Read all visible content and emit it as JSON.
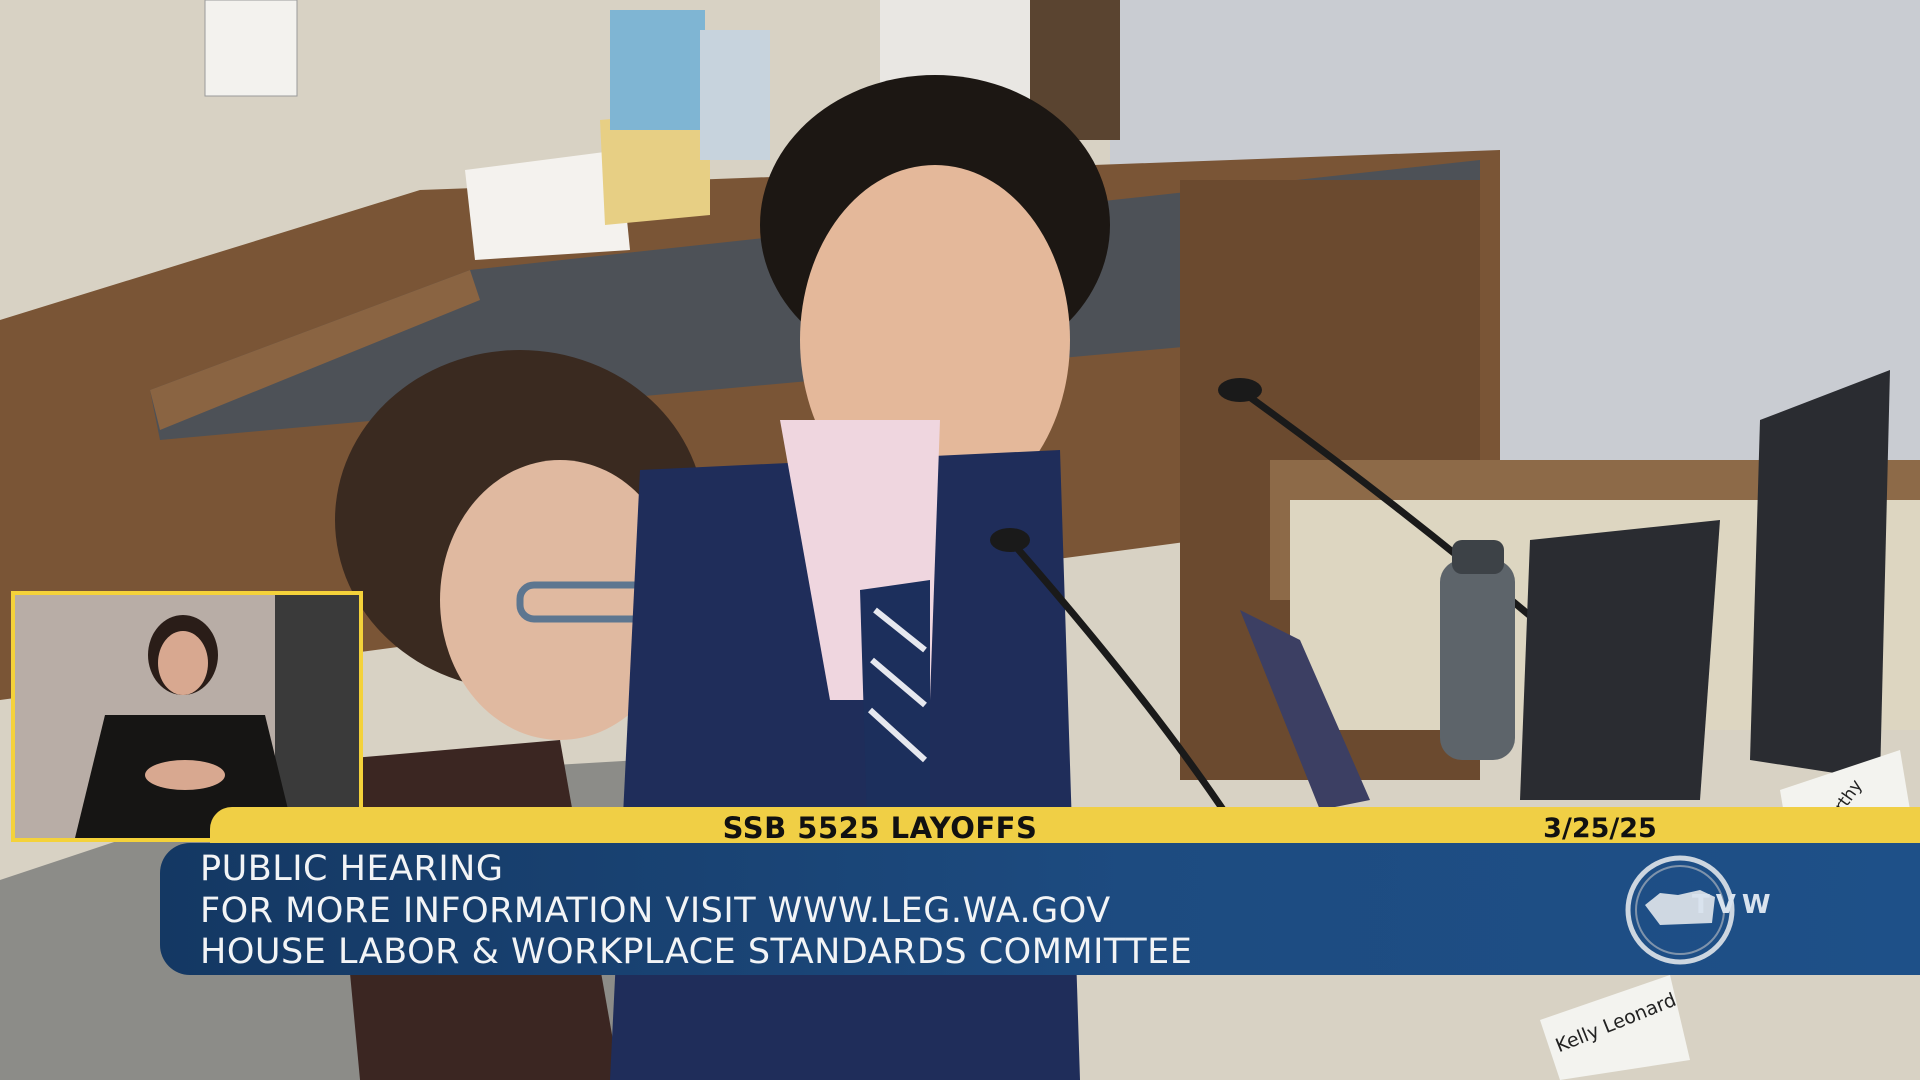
{
  "chyron": {
    "title": "SSB 5525 LAYOFFS",
    "date": "3/25/25",
    "lines": [
      "PUBLIC HEARING",
      "FOR MORE INFORMATION VISIT WWW.LEG.WA.GOV",
      "HOUSE LABOR & WORKPLACE STANDARDS COMMITTEE"
    ]
  },
  "logo": {
    "text": "TVW"
  },
  "nameplates": {
    "front": "Kelly Leonard",
    "back": "McCarthy"
  },
  "colors": {
    "chyron_yellow": "#f0cf45",
    "chyron_blue": "#1d4b80",
    "inset_border": "#f4d23a"
  }
}
